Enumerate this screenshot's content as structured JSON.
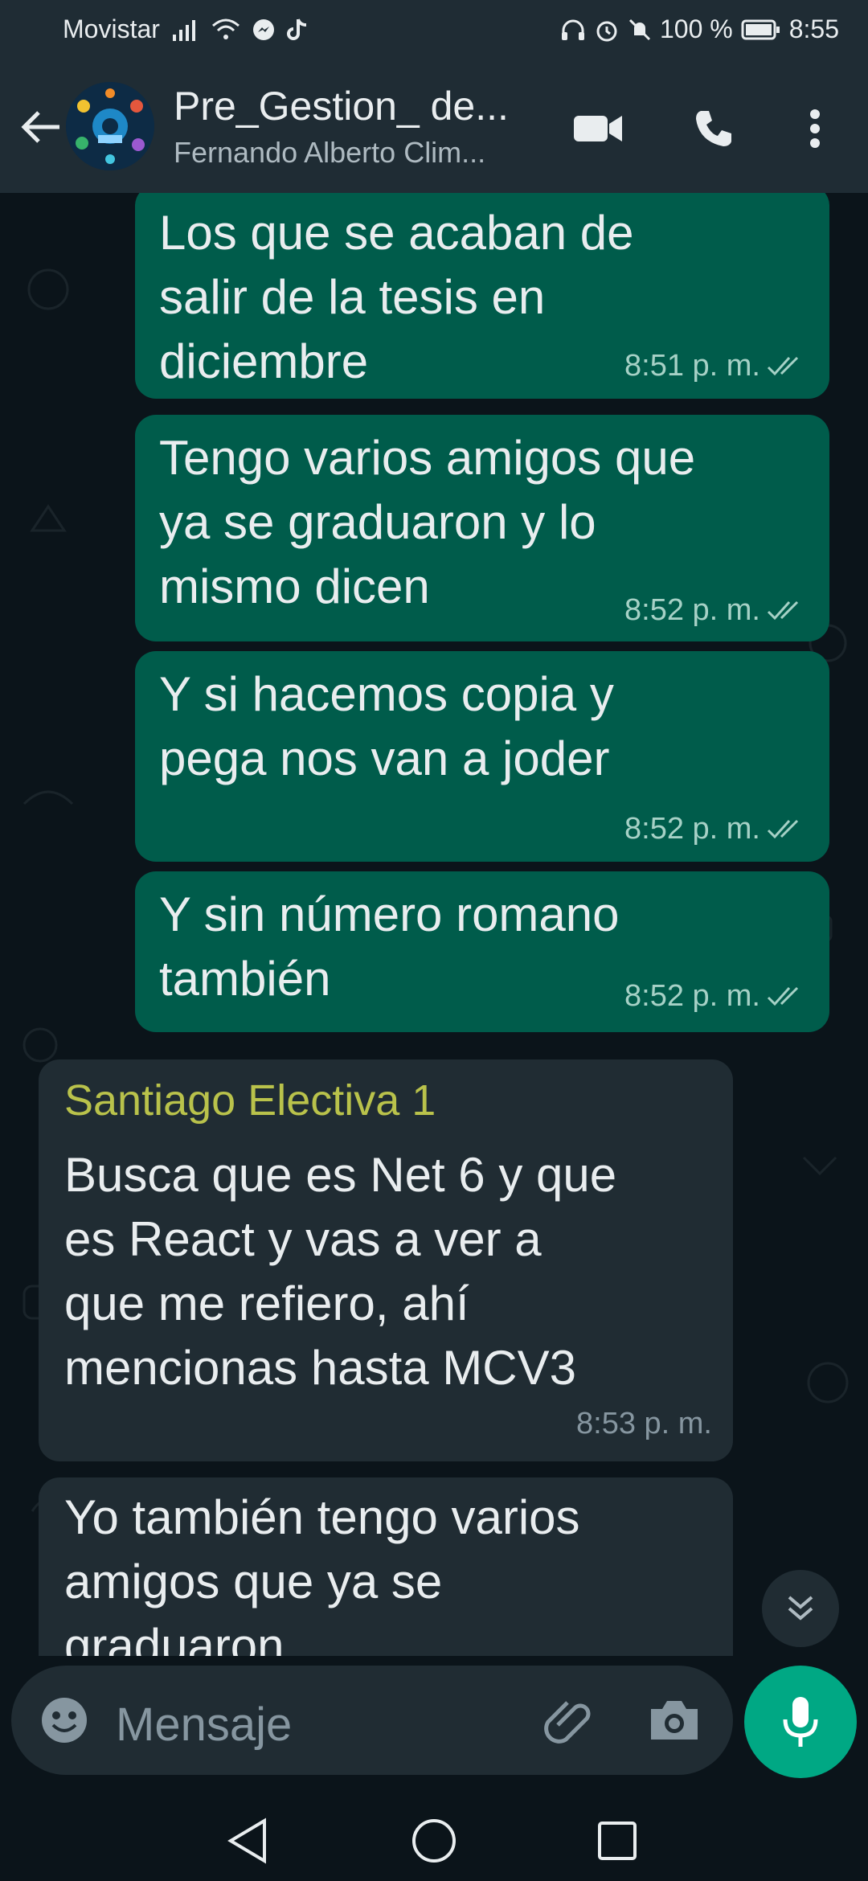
{
  "status_bar": {
    "carrier": "Movistar",
    "battery": "100 %",
    "time": "8:55"
  },
  "header": {
    "title": "Pre_Gestion_ de...",
    "subtitle": "Fernando Alberto Clim..."
  },
  "messages": [
    {
      "direction": "out",
      "text": [
        "Los que se acaban de",
        "salir de la tesis en",
        "diciembre"
      ],
      "time": "8:51 p. m."
    },
    {
      "direction": "out",
      "text": [
        "Tengo varios amigos que",
        "ya se graduaron y lo",
        "mismo dicen"
      ],
      "time": "8:52 p. m."
    },
    {
      "direction": "out",
      "text": [
        "Y si hacemos copia y",
        "pega nos van a joder"
      ],
      "time": "8:52 p. m."
    },
    {
      "direction": "out",
      "text": [
        "Y sin número romano",
        "también"
      ],
      "time": "8:52 p. m."
    },
    {
      "direction": "in",
      "sender": "Santiago Electiva 1",
      "text": [
        "Busca que es Net 6 y que",
        "es React y vas a ver a",
        "que me refiero, ahí",
        "mencionas hasta MCV3"
      ],
      "time": "8:53 p. m."
    },
    {
      "direction": "in",
      "text": [
        "Yo también tengo varios",
        "amigos que ya se",
        "graduaron"
      ],
      "time": ""
    }
  ],
  "composer": {
    "placeholder": "Mensaje"
  },
  "colors": {
    "outgoing": "#005c4b",
    "incoming": "#202c33",
    "accent": "#00a884",
    "sender": "#b9c24b"
  },
  "icons": [
    "back-arrow-icon",
    "video-call-icon",
    "phone-icon",
    "more-vertical-icon",
    "emoji-icon",
    "attach-icon",
    "camera-icon",
    "mic-icon",
    "chevron-down-double-icon",
    "nav-back-icon",
    "nav-home-icon",
    "nav-recents-icon"
  ]
}
